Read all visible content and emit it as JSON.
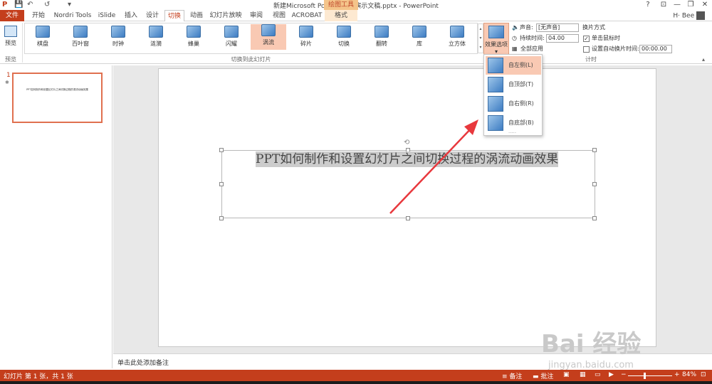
{
  "window": {
    "title": "新建Microsoft PowerPoint 演示文稿.pptx - PowerPoint",
    "help": "?",
    "min": "—",
    "restore": "❐",
    "close": "✕",
    "user": "H·  Bee"
  },
  "qat": {
    "save": "💾",
    "undo": "↶",
    "redo": "↺",
    "customize": "▾"
  },
  "contextual_group": "绘图工具",
  "tabs": [
    "文件",
    "开始",
    "Nordri Tools",
    "iSlide",
    "插入",
    "设计",
    "切换",
    "动画",
    "幻灯片放映",
    "审阅",
    "视图",
    "ACROBAT",
    "格式"
  ],
  "active_tab": "切换",
  "ribbon": {
    "preview_label": "预览",
    "preview_group": "预览",
    "transitions_group": "切换到此幻灯片",
    "timing_group": "计时",
    "gallery": [
      "棋盘",
      "百叶窗",
      "时钟",
      "涟漪",
      "蜂巢",
      "闪耀",
      "涡流",
      "碎片",
      "切换",
      "翻转",
      "库",
      "立方体"
    ],
    "selected_transition": "涡流",
    "effect_options": "效果选项",
    "effect_options_arrow": "▾",
    "sound_label": "声音:",
    "sound_value": "[无声音]",
    "duration_label": "持续时间:",
    "duration_value": "04.00",
    "apply_all": "全部应用",
    "advance_label": "换片方式",
    "on_click": "单击鼠标时",
    "after_label": "设置自动换片时间:",
    "after_value": "00:00.00"
  },
  "effect_dropdown": {
    "items": [
      "自左侧(L)",
      "自顶部(T)",
      "自右侧(R)",
      "自底部(B)"
    ],
    "selected_index": 0,
    "more": "....."
  },
  "thumbnail": {
    "number": "1",
    "star": "✱",
    "text": "PPT如何制作和设置幻灯片之间切换过程的涡流动画效果"
  },
  "slide": {
    "title": "PPT如何制作和设置幻灯片之间切换过程的涡流动画效果"
  },
  "notes_placeholder": "单击此处添加备注",
  "status": {
    "slide_info": "幻灯片 第 1 张，共 1 张",
    "notes": "备注",
    "comments": "批注",
    "zoom": "84%"
  },
  "watermark": {
    "logo": "Bai 经验",
    "url": "jingyan.baidu.com"
  },
  "colors": {
    "accent": "#c43e1c",
    "selected_fill": "#f9c9b3",
    "annotation_arrow": "#e8383d"
  }
}
